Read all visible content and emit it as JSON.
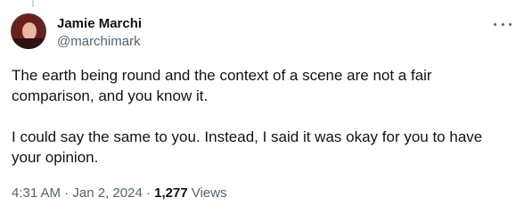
{
  "author": {
    "name": "Jamie Marchi",
    "handle": "@marchimark"
  },
  "tweet": {
    "paragraph_1": "The earth being round and the context of a scene are not a fair\ncomparison, and you know it.",
    "paragraph_2": "I could say the same to you. Instead, I said it was okay for you to have\nyour opinion."
  },
  "meta": {
    "time": "4:31 AM",
    "separator_1": " · ",
    "date": "Jan 2, 2024",
    "separator_2": " · ",
    "views_count": "1,277",
    "views_label": " Views"
  },
  "icons": {
    "more": "more-horizontal-icon"
  },
  "colors": {
    "text_primary": "#0f1419",
    "text_secondary": "#536471",
    "background": "#ffffff",
    "thread_line": "#cfd9de"
  }
}
